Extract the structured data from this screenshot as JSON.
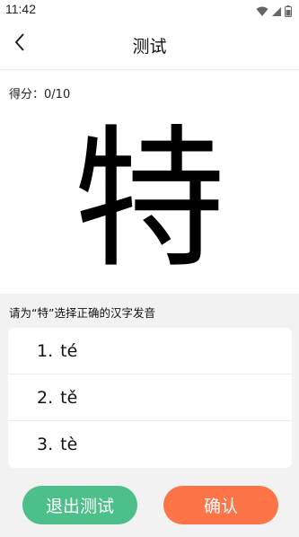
{
  "status_bar": {
    "time": "11:42",
    "icons": [
      "wifi-icon",
      "signal-icon",
      "battery-icon"
    ]
  },
  "header": {
    "back_icon": "chevron-left-icon",
    "title": "测试"
  },
  "score": {
    "label": "得分：",
    "value": "0/10"
  },
  "character": "特",
  "question": "请为“特”选择正确的汉字发音",
  "options": [
    {
      "number": "1.",
      "text": "té"
    },
    {
      "number": "2.",
      "text": "tě"
    },
    {
      "number": "3.",
      "text": "tè"
    }
  ],
  "buttons": {
    "exit": "退出测试",
    "confirm": "确认"
  },
  "colors": {
    "exit_button": "#4cbf8a",
    "confirm_button": "#fc7448",
    "quiz_background": "#f2f2f2"
  }
}
